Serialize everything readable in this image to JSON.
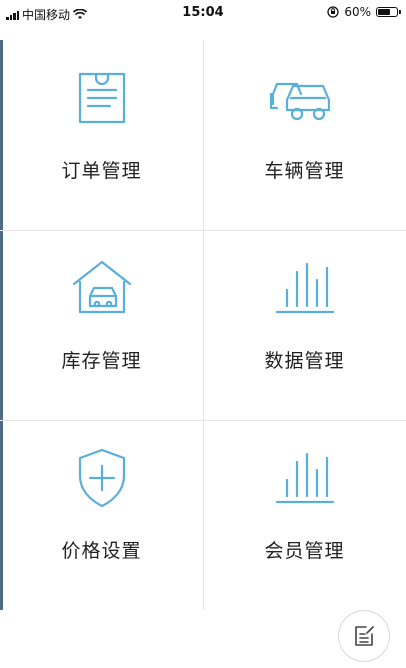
{
  "status": {
    "carrier": "中国移动",
    "time": "15:04",
    "battery": "60%",
    "battery_level": 0.6
  },
  "menu": [
    {
      "label": "订单管理",
      "icon": "order-document-icon"
    },
    {
      "label": "车辆管理",
      "icon": "vehicles-icon"
    },
    {
      "label": "库存管理",
      "icon": "garage-inventory-icon"
    },
    {
      "label": "数据管理",
      "icon": "bar-chart-icon"
    },
    {
      "label": "价格设置",
      "icon": "shield-plus-icon"
    },
    {
      "label": "会员管理",
      "icon": "bar-chart-icon"
    }
  ],
  "colors": {
    "icon": "#5aaedb",
    "divider": "#e6e6e6"
  },
  "fab": {
    "icon": "edit-note-icon"
  }
}
